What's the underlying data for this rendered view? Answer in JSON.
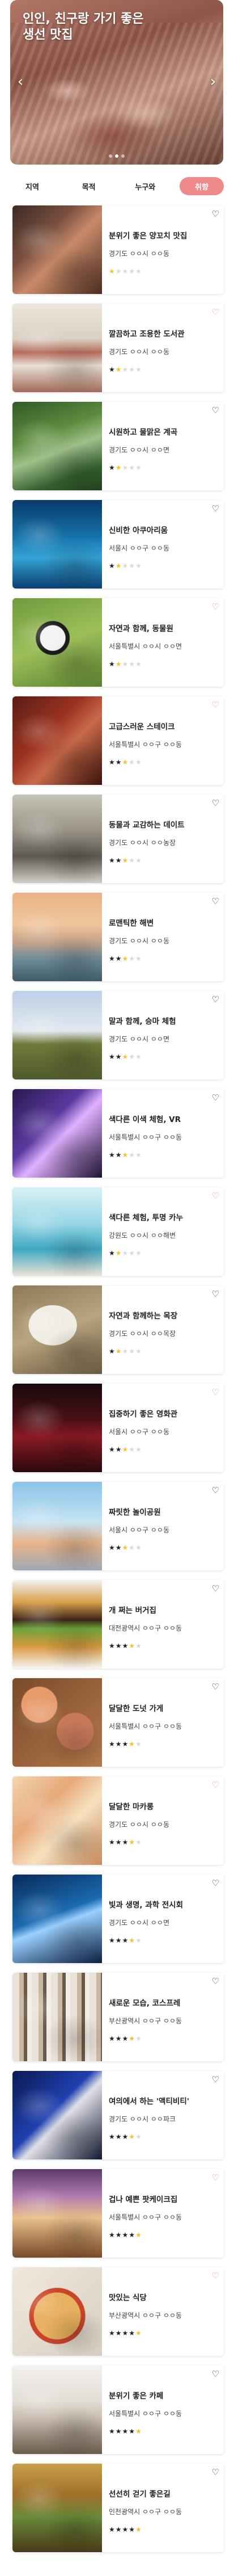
{
  "banner": {
    "title": "인인, 친구랑 가기 좋은\n생선 맛집",
    "prev_label": "‹",
    "next_label": "›",
    "slides": 3,
    "active_slide": 1
  },
  "tabs": [
    {
      "label": "지역",
      "active": false
    },
    {
      "label": "목적",
      "active": false
    },
    {
      "label": "누구와",
      "active": false
    },
    {
      "label": "취향",
      "active": true
    }
  ],
  "colors": {
    "accent": "#f08a8a",
    "star_on": "#222222",
    "star_half": "#f2c230",
    "star_off": "#d8d8d8"
  },
  "places": [
    {
      "title": "분위기 좋은 양꼬치 맛집",
      "address": "경기도 ㅇㅇ시 ㅇㅇ동",
      "rating": 0,
      "liked": false,
      "thumb": "bbq"
    },
    {
      "title": "깔끔하고 조용한 도서관",
      "address": "경기도 ㅇㅇ시 ㅇㅇ동",
      "rating": 1,
      "liked": true,
      "thumb": "library"
    },
    {
      "title": "시원하고 물맑은 계곡",
      "address": "경기도 ㅇㅇ시 ㅇㅇ면",
      "rating": 1,
      "liked": false,
      "thumb": "valley"
    },
    {
      "title": "신비한 아쿠아리움",
      "address": "서울시 ㅇㅇ구 ㅇㅇ동",
      "rating": 1,
      "liked": false,
      "thumb": "aquarium"
    },
    {
      "title": "자연과 함께, 동물원",
      "address": "서울특별시 ㅇㅇ시 ㅇㅇ면",
      "rating": 1,
      "liked": true,
      "thumb": "panda"
    },
    {
      "title": "고급스러운 스테이크",
      "address": "서울특별시 ㅇㅇ구 ㅇㅇ동",
      "rating": 2,
      "liked": true,
      "thumb": "steak"
    },
    {
      "title": "동물과 교감하는 데이트",
      "address": "경기도 ㅇㅇ시 ㅇㅇ농장",
      "rating": 2,
      "liked": false,
      "thumb": "ostrich"
    },
    {
      "title": "로맨틱한 해변",
      "address": "경기도 ㅇㅇ시 ㅇㅇ동",
      "rating": 2,
      "liked": false,
      "thumb": "beach"
    },
    {
      "title": "말과 함께, 승마 체험",
      "address": "경기도 ㅇㅇ시 ㅇㅇ면",
      "rating": 2,
      "liked": false,
      "thumb": "horse"
    },
    {
      "title": "색다른 이색 체험, VR",
      "address": "서울특별시 ㅇㅇ구 ㅇㅇ동",
      "rating": 2,
      "liked": false,
      "thumb": "vr"
    },
    {
      "title": "색다른 체험, 투명 카누",
      "address": "강원도 ㅇㅇ시 ㅇㅇ해변",
      "rating": 1,
      "liked": true,
      "thumb": "canoe"
    },
    {
      "title": "자연과 함께하는 목장",
      "address": "경기도 ㅇㅇ시 ㅇㅇ목장",
      "rating": 1,
      "liked": false,
      "thumb": "sheep"
    },
    {
      "title": "집중하기 좋은 영화관",
      "address": "서울시 ㅇㅇ구 ㅇㅇ동",
      "rating": 2,
      "liked": true,
      "thumb": "cinema"
    },
    {
      "title": "짜릿한 놀이공원",
      "address": "서울시 ㅇㅇ구 ㅇㅇ동",
      "rating": 2,
      "liked": false,
      "thumb": "park"
    },
    {
      "title": "개 쩌는 버거집",
      "address": "대전광역시 ㅇㅇ구 ㅇㅇ동",
      "rating": 3,
      "liked": false,
      "thumb": "burger"
    },
    {
      "title": "달달한 도넛 가게",
      "address": "서울특별시 ㅇㅇ구 ㅇㅇ동",
      "rating": 3,
      "liked": false,
      "thumb": "donut"
    },
    {
      "title": "달달한 마카롱",
      "address": "경기도 ㅇㅇ시 ㅇㅇ동",
      "rating": 3,
      "liked": true,
      "thumb": "macaron"
    },
    {
      "title": "빛과 생명, 과학 전시회",
      "address": "경기도 ㅇㅇ시 ㅇㅇ면",
      "rating": 3,
      "liked": false,
      "thumb": "prism"
    },
    {
      "title": "새로운 모습, 코스프레",
      "address": "부산광역시 ㅇㅇ구 ㅇㅇ동",
      "rating": 3,
      "liked": false,
      "thumb": "clothes"
    },
    {
      "title": "여의에서 하는 '액티비티'",
      "address": "경기도 ㅇㅇ시 ㅇㅇ파크",
      "rating": 3,
      "liked": false,
      "thumb": "kart"
    },
    {
      "title": "겁나 예쁜 팟케이크집",
      "address": "서울특별시 ㅇㅇ구 ㅇㅇ동",
      "rating": 4,
      "liked": true,
      "thumb": "pancake"
    },
    {
      "title": "맛있는 식당",
      "address": "부산광역시 ㅇㅇ구 ㅇㅇ동",
      "rating": 4,
      "liked": true,
      "thumb": "pizza"
    },
    {
      "title": "분위기 좋은 카페",
      "address": "서울특별시 ㅇㅇ구 ㅇㅇ동",
      "rating": 4,
      "liked": false,
      "thumb": "cafe"
    },
    {
      "title": "선선히 걷기 좋은길",
      "address": "인천광역시 ㅇㅇ구 ㅇㅇ동",
      "rating": 4,
      "liked": false,
      "thumb": "autumn"
    }
  ]
}
